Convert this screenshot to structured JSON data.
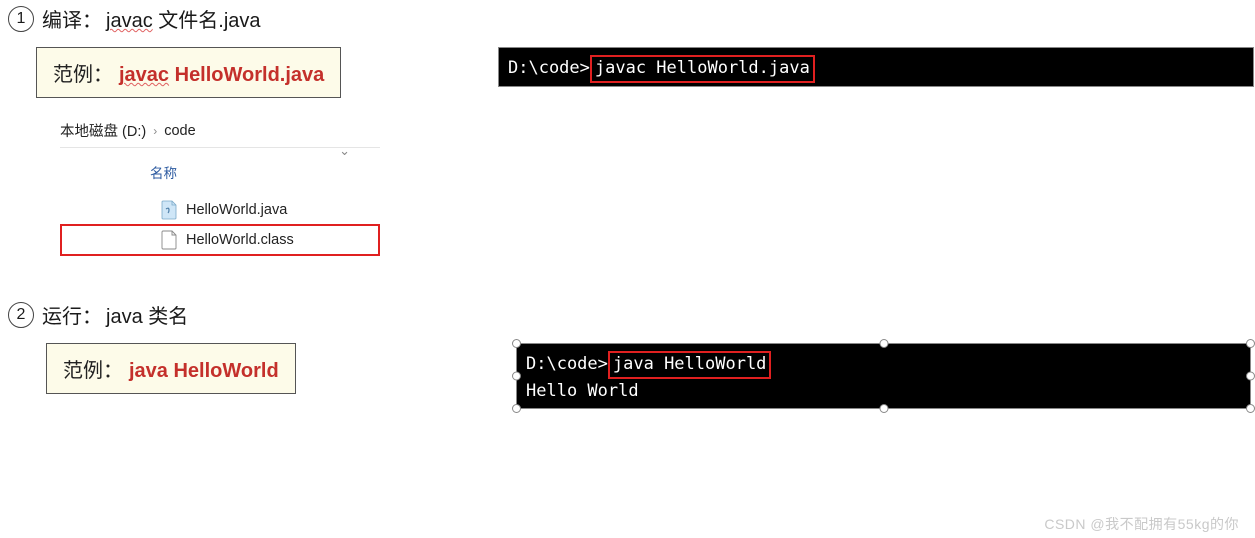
{
  "section1": {
    "num": "1",
    "title_label": "编译：",
    "title_cmd_a": "javac",
    "title_cmd_b": " 文件名.java",
    "example_label": "范例：",
    "example_cmd_a": "javac",
    "example_cmd_b": " HelloWorld.java",
    "terminal": {
      "prompt": "D:\\code>",
      "cmd": "javac HelloWorld.java"
    },
    "explorer": {
      "crumb_disk": "本地磁盘 (D:)",
      "crumb_folder": "code",
      "column_header": "名称",
      "files": [
        {
          "name": "HelloWorld.java",
          "highlighted": false,
          "icon": "java"
        },
        {
          "name": "HelloWorld.class",
          "highlighted": true,
          "icon": "blank"
        }
      ]
    }
  },
  "section2": {
    "num": "2",
    "title_label": "运行：",
    "title_cmd": "java 类名",
    "example_label": "范例：",
    "example_cmd": "java HelloWorld",
    "terminal": {
      "prompt": "D:\\code>",
      "cmd": "java HelloWorld",
      "output": "Hello World"
    }
  },
  "watermark": "CSDN @我不配拥有55kg的你"
}
